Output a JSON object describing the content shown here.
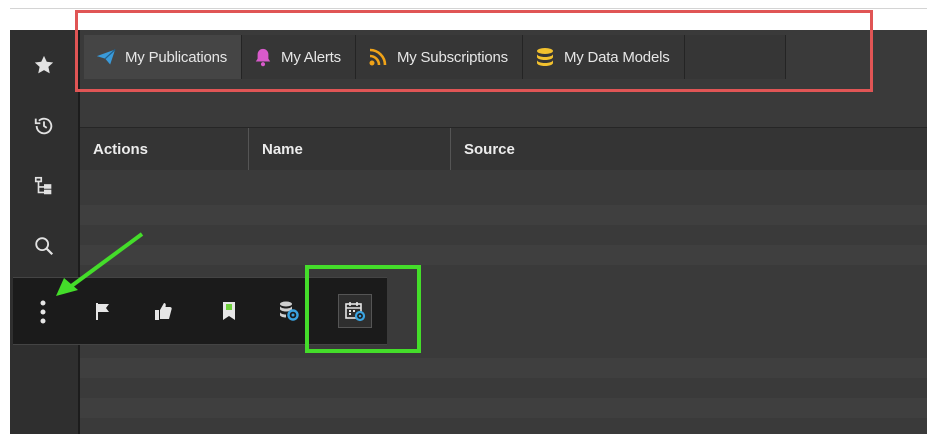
{
  "tabs": [
    {
      "label": "My Publications",
      "icon": "paper-plane-icon",
      "color": "#3a9ad9"
    },
    {
      "label": "My Alerts",
      "icon": "bell-icon",
      "color": "#d85acb"
    },
    {
      "label": "My Subscriptions",
      "icon": "rss-icon",
      "color": "#f0a318"
    },
    {
      "label": "My Data Models",
      "icon": "database-icon",
      "color": "#f2c12e"
    }
  ],
  "table": {
    "columns": [
      "Actions",
      "Name",
      "Source"
    ]
  },
  "sidebar": {
    "items": [
      "star-icon",
      "history-icon",
      "hierarchy-icon",
      "search-icon",
      "more-vertical-icon"
    ]
  },
  "action_bar": {
    "items": [
      "flag-icon",
      "thumbs-up-icon",
      "bookmark-icon",
      "database-settings-icon",
      "calendar-settings-icon"
    ]
  },
  "annotations": {
    "highlight_tabs_color": "#e05555",
    "highlight_scheduler_color": "#44dd2a",
    "arrow_color": "#44dd2a"
  }
}
